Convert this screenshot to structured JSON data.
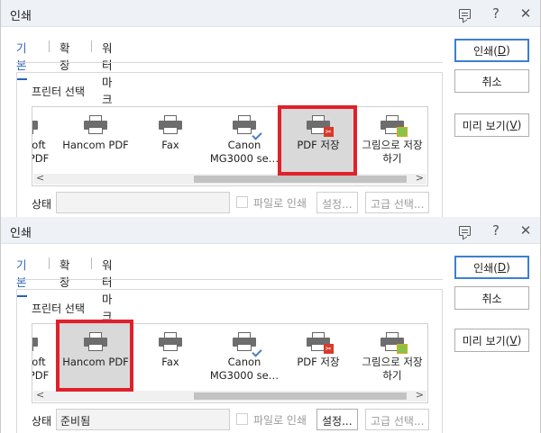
{
  "dialogs": [
    {
      "title": "인쇄",
      "tabs": [
        "기본",
        "확장",
        "워터마크"
      ],
      "group_title": "프린터 선택",
      "printers": [
        {
          "line1": "oft",
          "line2": "PDF",
          "icon": "printer-icon"
        },
        {
          "line1": "Hancom PDF",
          "line2": "",
          "icon": "printer-icon"
        },
        {
          "line1": "Fax",
          "line2": "",
          "icon": "printer-icon"
        },
        {
          "line1": "Canon",
          "line2": "MG3000 se…",
          "icon": "printer-default-icon"
        },
        {
          "line1": "PDF 저장",
          "line2": "",
          "icon": "pdf-save-printer-icon"
        },
        {
          "line1": "그림으로 저장",
          "line2": "하기",
          "icon": "image-save-printer-icon"
        }
      ],
      "selected_printer": "PDF 저장",
      "status_label": "상태",
      "status_value": "",
      "print_to_file_label": "파일로 인쇄",
      "settings_label": "설정...",
      "advanced_label": "고급 선택...",
      "print_button": {
        "text": "인쇄(",
        "key": "D",
        "end": ")"
      },
      "cancel_button": "취소",
      "preview_button": {
        "text": "미리 보기(",
        "key": "V",
        "end": ")"
      }
    },
    {
      "title": "인쇄",
      "tabs": [
        "기본",
        "확장",
        "워터마크"
      ],
      "group_title": "프린터 선택",
      "printers": [
        {
          "line1": "oft",
          "line2": "PDF",
          "icon": "printer-icon"
        },
        {
          "line1": "Hancom PDF",
          "line2": "",
          "icon": "printer-icon"
        },
        {
          "line1": "Fax",
          "line2": "",
          "icon": "printer-icon"
        },
        {
          "line1": "Canon",
          "line2": "MG3000 se…",
          "icon": "printer-default-icon"
        },
        {
          "line1": "PDF 저장",
          "line2": "",
          "icon": "pdf-save-printer-icon"
        },
        {
          "line1": "그림으로 저장",
          "line2": "하기",
          "icon": "image-save-printer-icon"
        }
      ],
      "selected_printer": "Hancom PDF",
      "status_label": "상태",
      "status_value": "준비됨",
      "print_to_file_label": "파일로 인쇄",
      "settings_label": "설정...",
      "advanced_label": "고급 선택...",
      "print_button": {
        "text": "인쇄(",
        "key": "D",
        "end": ")"
      },
      "cancel_button": "취소",
      "preview_button": {
        "text": "미리 보기(",
        "key": "V",
        "end": ")"
      }
    }
  ],
  "colors": {
    "accent": "#2a62b8",
    "highlight": "#e0202b",
    "selected_bg": "#d9d9d9"
  }
}
